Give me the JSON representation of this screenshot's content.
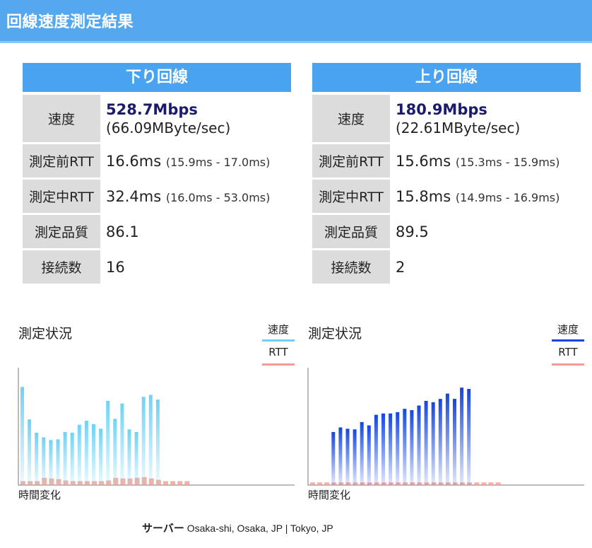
{
  "header": {
    "title": "回線速度測定結果"
  },
  "download": {
    "title": "下り回線",
    "rows": {
      "speed_label": "速度",
      "speed_value": "528.7Mbps",
      "speed_bytes": "(66.09MByte/sec)",
      "rtt_before_label": "測定前RTT",
      "rtt_before_value": "16.6ms",
      "rtt_before_range": "(15.9ms - 17.0ms)",
      "rtt_during_label": "測定中RTT",
      "rtt_during_value": "32.4ms",
      "rtt_during_range": "(16.0ms - 53.0ms)",
      "quality_label": "測定品質",
      "quality_value": "86.1",
      "connections_label": "接続数",
      "connections_value": "16"
    }
  },
  "upload": {
    "title": "上り回線",
    "rows": {
      "speed_label": "速度",
      "speed_value": "180.9Mbps",
      "speed_bytes": "(22.61MByte/sec)",
      "rtt_before_label": "測定前RTT",
      "rtt_before_value": "15.6ms",
      "rtt_before_range": "(15.3ms - 15.9ms)",
      "rtt_during_label": "測定中RTT",
      "rtt_during_value": "15.8ms",
      "rtt_during_range": "(14.9ms - 16.9ms)",
      "quality_label": "測定品質",
      "quality_value": "89.5",
      "connections_label": "接続数",
      "connections_value": "2"
    }
  },
  "graph_common": {
    "title": "測定状況",
    "legend_speed": "速度",
    "legend_rtt": "RTT",
    "x_label": "時間変化"
  },
  "colors": {
    "header": "#56a8ee",
    "panel_head": "#4aa3f0",
    "download_speed": "#6fd2f5",
    "upload_speed": "#1346e0",
    "rtt": "#f29d8e"
  },
  "chart_data": [
    {
      "type": "bar",
      "title": "測定状況",
      "xlabel": "時間変化",
      "series": [
        {
          "name": "速度",
          "values": [
            148,
            99,
            79,
            72,
            68,
            69,
            80,
            79,
            91,
            97,
            92,
            85,
            127,
            100,
            123,
            84,
            80,
            133,
            136,
            129,
            0,
            0,
            0,
            0
          ]
        },
        {
          "name": "RTT",
          "values": [
            6,
            6,
            6,
            11,
            10,
            9,
            7,
            6,
            6,
            6,
            6,
            6,
            7,
            11,
            10,
            10,
            11,
            12,
            10,
            8,
            6,
            6,
            6,
            6
          ]
        }
      ],
      "ylim": [
        0,
        160
      ]
    },
    {
      "type": "bar",
      "title": "測定状況",
      "xlabel": "時間変化",
      "series": [
        {
          "name": "速度",
          "values": [
            0,
            0,
            0,
            80,
            87,
            85,
            84,
            95,
            90,
            106,
            108,
            108,
            110,
            115,
            113,
            120,
            127,
            125,
            130,
            138,
            130,
            147,
            145,
            0,
            0,
            0,
            0
          ]
        },
        {
          "name": "RTT",
          "values": [
            4,
            4,
            4,
            4,
            4,
            4,
            4,
            4,
            4,
            4,
            4,
            4,
            4,
            4,
            4,
            4,
            4,
            4,
            4,
            4,
            4,
            4,
            4,
            4,
            4,
            4,
            4
          ]
        }
      ],
      "ylim": [
        0,
        160
      ]
    }
  ],
  "server": {
    "label": "サーバー",
    "value": "Osaka-shi, Osaka, JP  |  Tokyo, JP"
  }
}
